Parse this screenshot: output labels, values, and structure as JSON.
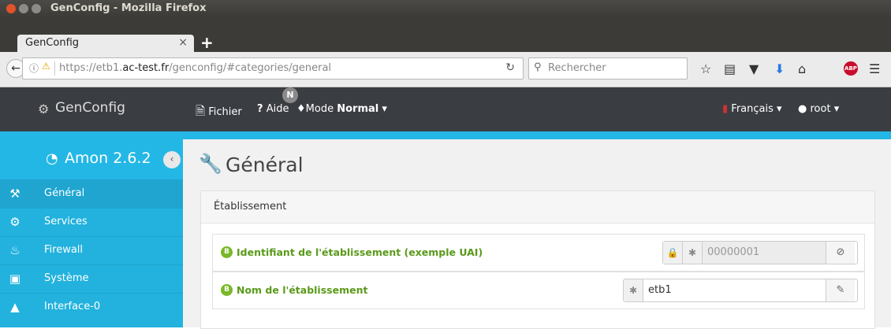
{
  "window": {
    "title": "GenConfig - Mozilla Firefox"
  },
  "browser": {
    "tab_label": "GenConfig",
    "tab_close": "×",
    "new_tab": "+",
    "url_host_prefix": "https://etb1.",
    "url_host_main": "ac-test.fr",
    "url_path": "/genconfig/#categories/general",
    "search_placeholder": "Rechercher",
    "abp_label": "ABP"
  },
  "appbar": {
    "brand": "GenConfig",
    "file_menu": "Fichier",
    "help_menu": "Aide",
    "mode_badge": "N",
    "mode_label": "Mode",
    "mode_value": "Normal",
    "language": "Français",
    "user": "root"
  },
  "sidebar": {
    "header": "Amon 2.6.2",
    "collapse": "‹",
    "items": [
      {
        "label": "Général",
        "icon": "wrench-icon"
      },
      {
        "label": "Services",
        "icon": "cogs-icon"
      },
      {
        "label": "Firewall",
        "icon": "fire-icon"
      },
      {
        "label": "Système",
        "icon": "monitor-icon"
      },
      {
        "label": "Interface-0",
        "icon": "sitemap-icon"
      }
    ]
  },
  "main": {
    "title": "Général",
    "panel_title": "Établissement",
    "fields": [
      {
        "badge": "B",
        "label": "Identifiant de l'établissement (exemple UAI)",
        "value": "00000001",
        "locked": true
      },
      {
        "badge": "B",
        "label": "Nom de l'établissement",
        "value": "etb1",
        "locked": false
      }
    ]
  },
  "colors": {
    "accent": "#23b7e5",
    "field_label": "#5a9a1a",
    "topbar": "#3a3d42"
  }
}
